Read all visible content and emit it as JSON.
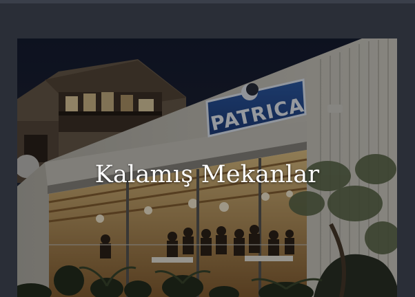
{
  "card": {
    "title": "Kalamış Mekanlar",
    "sign_text": "PATRICA"
  },
  "colors": {
    "page_background": "#2a2e37",
    "title_text": "#ffffff"
  }
}
